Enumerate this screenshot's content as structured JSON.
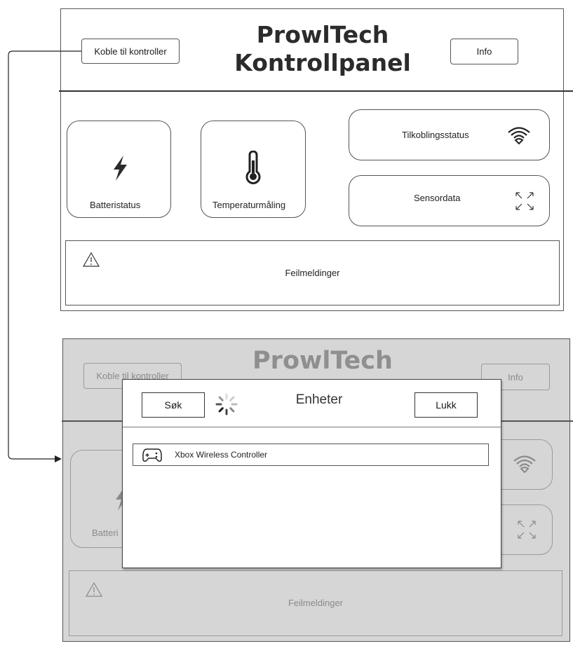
{
  "panel": {
    "title_line1": "ProwlTech",
    "title_line2": "Kontrollpanel",
    "connect_button": "Koble til kontroller",
    "info_button": "Info",
    "tiles": {
      "battery": "Batteristatus",
      "temperature": "Temperaturmåling",
      "connection": "Tilkoblingsstatus",
      "sensor": "Sensordata"
    },
    "errors_label": "Feilmeldinger"
  },
  "dimmed_panel": {
    "title_line1": "ProwlTech",
    "connect_button": "Koble til kontroller",
    "info_button": "Info",
    "battery_partial": "Batteri",
    "errors_label": "Feilmeldinger"
  },
  "modal": {
    "title": "Enheter",
    "search_button": "Søk",
    "close_button": "Lukk",
    "devices": [
      {
        "name": "Xbox Wireless Controller",
        "icon": "gamepad-icon"
      }
    ]
  },
  "icons": {
    "battery": "lightning-icon",
    "temperature": "thermometer-icon",
    "connection": "wifi-icon",
    "sensor": "expand-icon",
    "errors": "warning-icon",
    "loading": "spinner-icon"
  },
  "colors": {
    "dim_background": "#d6d6d6",
    "border": "#555555",
    "text": "#1a1a1a"
  }
}
